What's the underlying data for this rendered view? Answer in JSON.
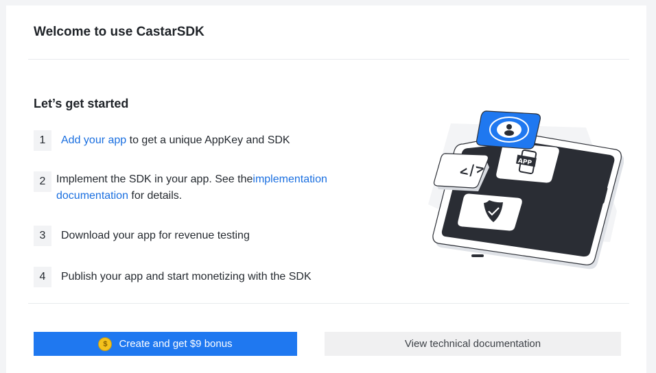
{
  "header": {
    "title": "Welcome to use CastarSDK"
  },
  "getting_started": {
    "title": "Let’s get started",
    "steps": [
      {
        "num": "1",
        "link": "Add your app",
        "text": " to get a unique AppKey and SDK"
      },
      {
        "num": "2",
        "text_before": "Implement the SDK in your app. See the",
        "link": "implementation documentation",
        "text_after": " for details."
      },
      {
        "num": "3",
        "text": "Download your app for revenue testing"
      },
      {
        "num": "4",
        "text": "Publish your app and start monetizing with the SDK"
      }
    ]
  },
  "illustration": {
    "icons": [
      "user-icon",
      "code-icon",
      "app-icon",
      "shield-check-icon",
      "phone-icon"
    ],
    "tile_label": "APP"
  },
  "actions": {
    "primary_label": "Create and get $9 bonus",
    "coin_symbol": "$",
    "secondary_label": "View technical documentation"
  },
  "colors": {
    "accent": "#1f78f0",
    "link": "#1a6fe0",
    "coin": "#f4c21d",
    "phone_screen": "#2a2d34"
  }
}
